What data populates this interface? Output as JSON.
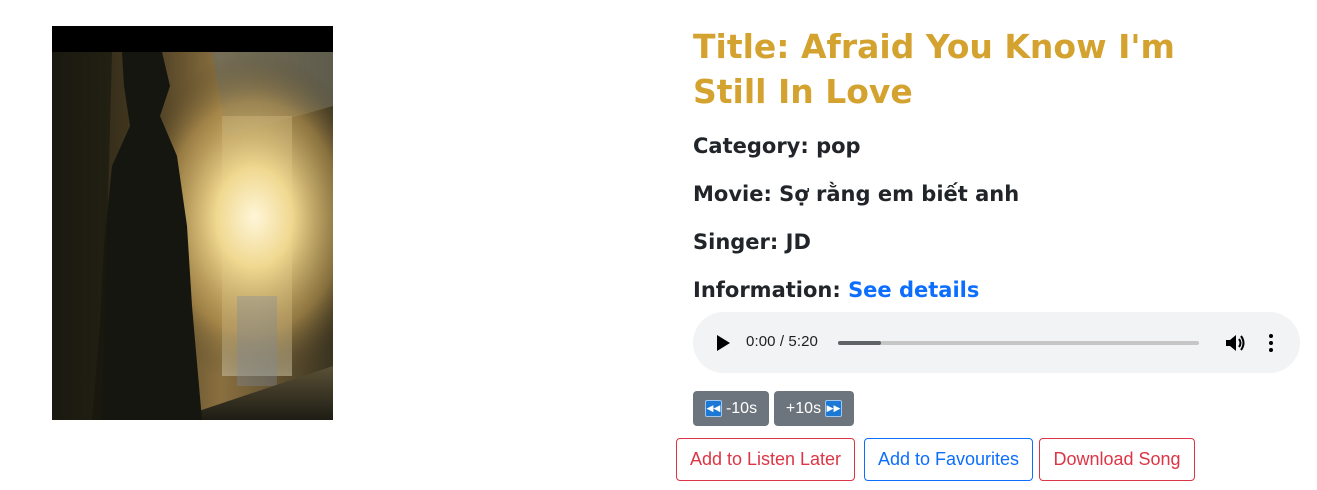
{
  "song": {
    "title": "Title: Afraid You Know I'm Still In Love",
    "category_label": "Category: ",
    "category": "pop",
    "movie_label": "Movie: ",
    "movie": "Sợ rằng em biết anh",
    "singer_label": "Singer: ",
    "singer": "JD",
    "information_label": "Information: ",
    "details_link": "See details"
  },
  "player": {
    "time": "0:00 / 5:20",
    "progress_fraction": 0.12,
    "icons": [
      "play-icon",
      "volume-icon",
      "more-vertical-icon"
    ]
  },
  "seek_buttons": {
    "back_label": "-10s",
    "forward_label": "+10s",
    "back_icon": "rewind-icon",
    "forward_icon": "fast-forward-icon"
  },
  "actions": {
    "listen_later": "Add to Listen Later",
    "favourites": "Add to Favourites",
    "download": "Download Song"
  },
  "colors": {
    "title": "#d4a22f",
    "link": "#0d6efd",
    "danger": "#dc3545",
    "secondary": "#6c757d"
  }
}
